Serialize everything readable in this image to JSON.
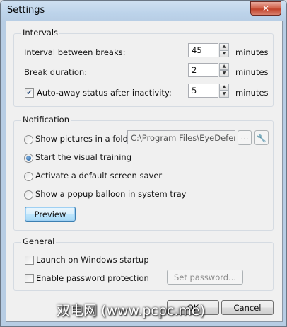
{
  "window": {
    "title": "Settings"
  },
  "intervals": {
    "group_title": "Intervals",
    "break_interval": {
      "label": "Interval between breaks:",
      "value": "45",
      "unit": "minutes"
    },
    "break_duration": {
      "label": "Break duration:",
      "value": "2",
      "unit": "minutes"
    },
    "auto_away": {
      "label": "Auto-away status after inactivity:",
      "checked": true,
      "value": "5",
      "unit": "minutes"
    }
  },
  "notification": {
    "group_title": "Notification",
    "options": [
      {
        "label": "Show pictures in a folder:",
        "selected": false
      },
      {
        "label": "Start the visual training",
        "selected": true
      },
      {
        "label": "Activate a default screen saver",
        "selected": false
      },
      {
        "label": "Show a popup balloon in system tray",
        "selected": false
      }
    ],
    "folder_path": "C:\\Program Files\\EyeDefender",
    "browse_label": "...",
    "preview_label": "Preview"
  },
  "general": {
    "group_title": "General",
    "launch_on_startup": {
      "label": "Launch on Windows startup",
      "checked": false
    },
    "password_protection": {
      "label": "Enable password protection",
      "checked": false
    },
    "set_password_label": "Set password..."
  },
  "footer": {
    "ok_label": "OK",
    "cancel_label": "Cancel"
  },
  "watermark": "双电网 (www.pcpc.me)"
}
